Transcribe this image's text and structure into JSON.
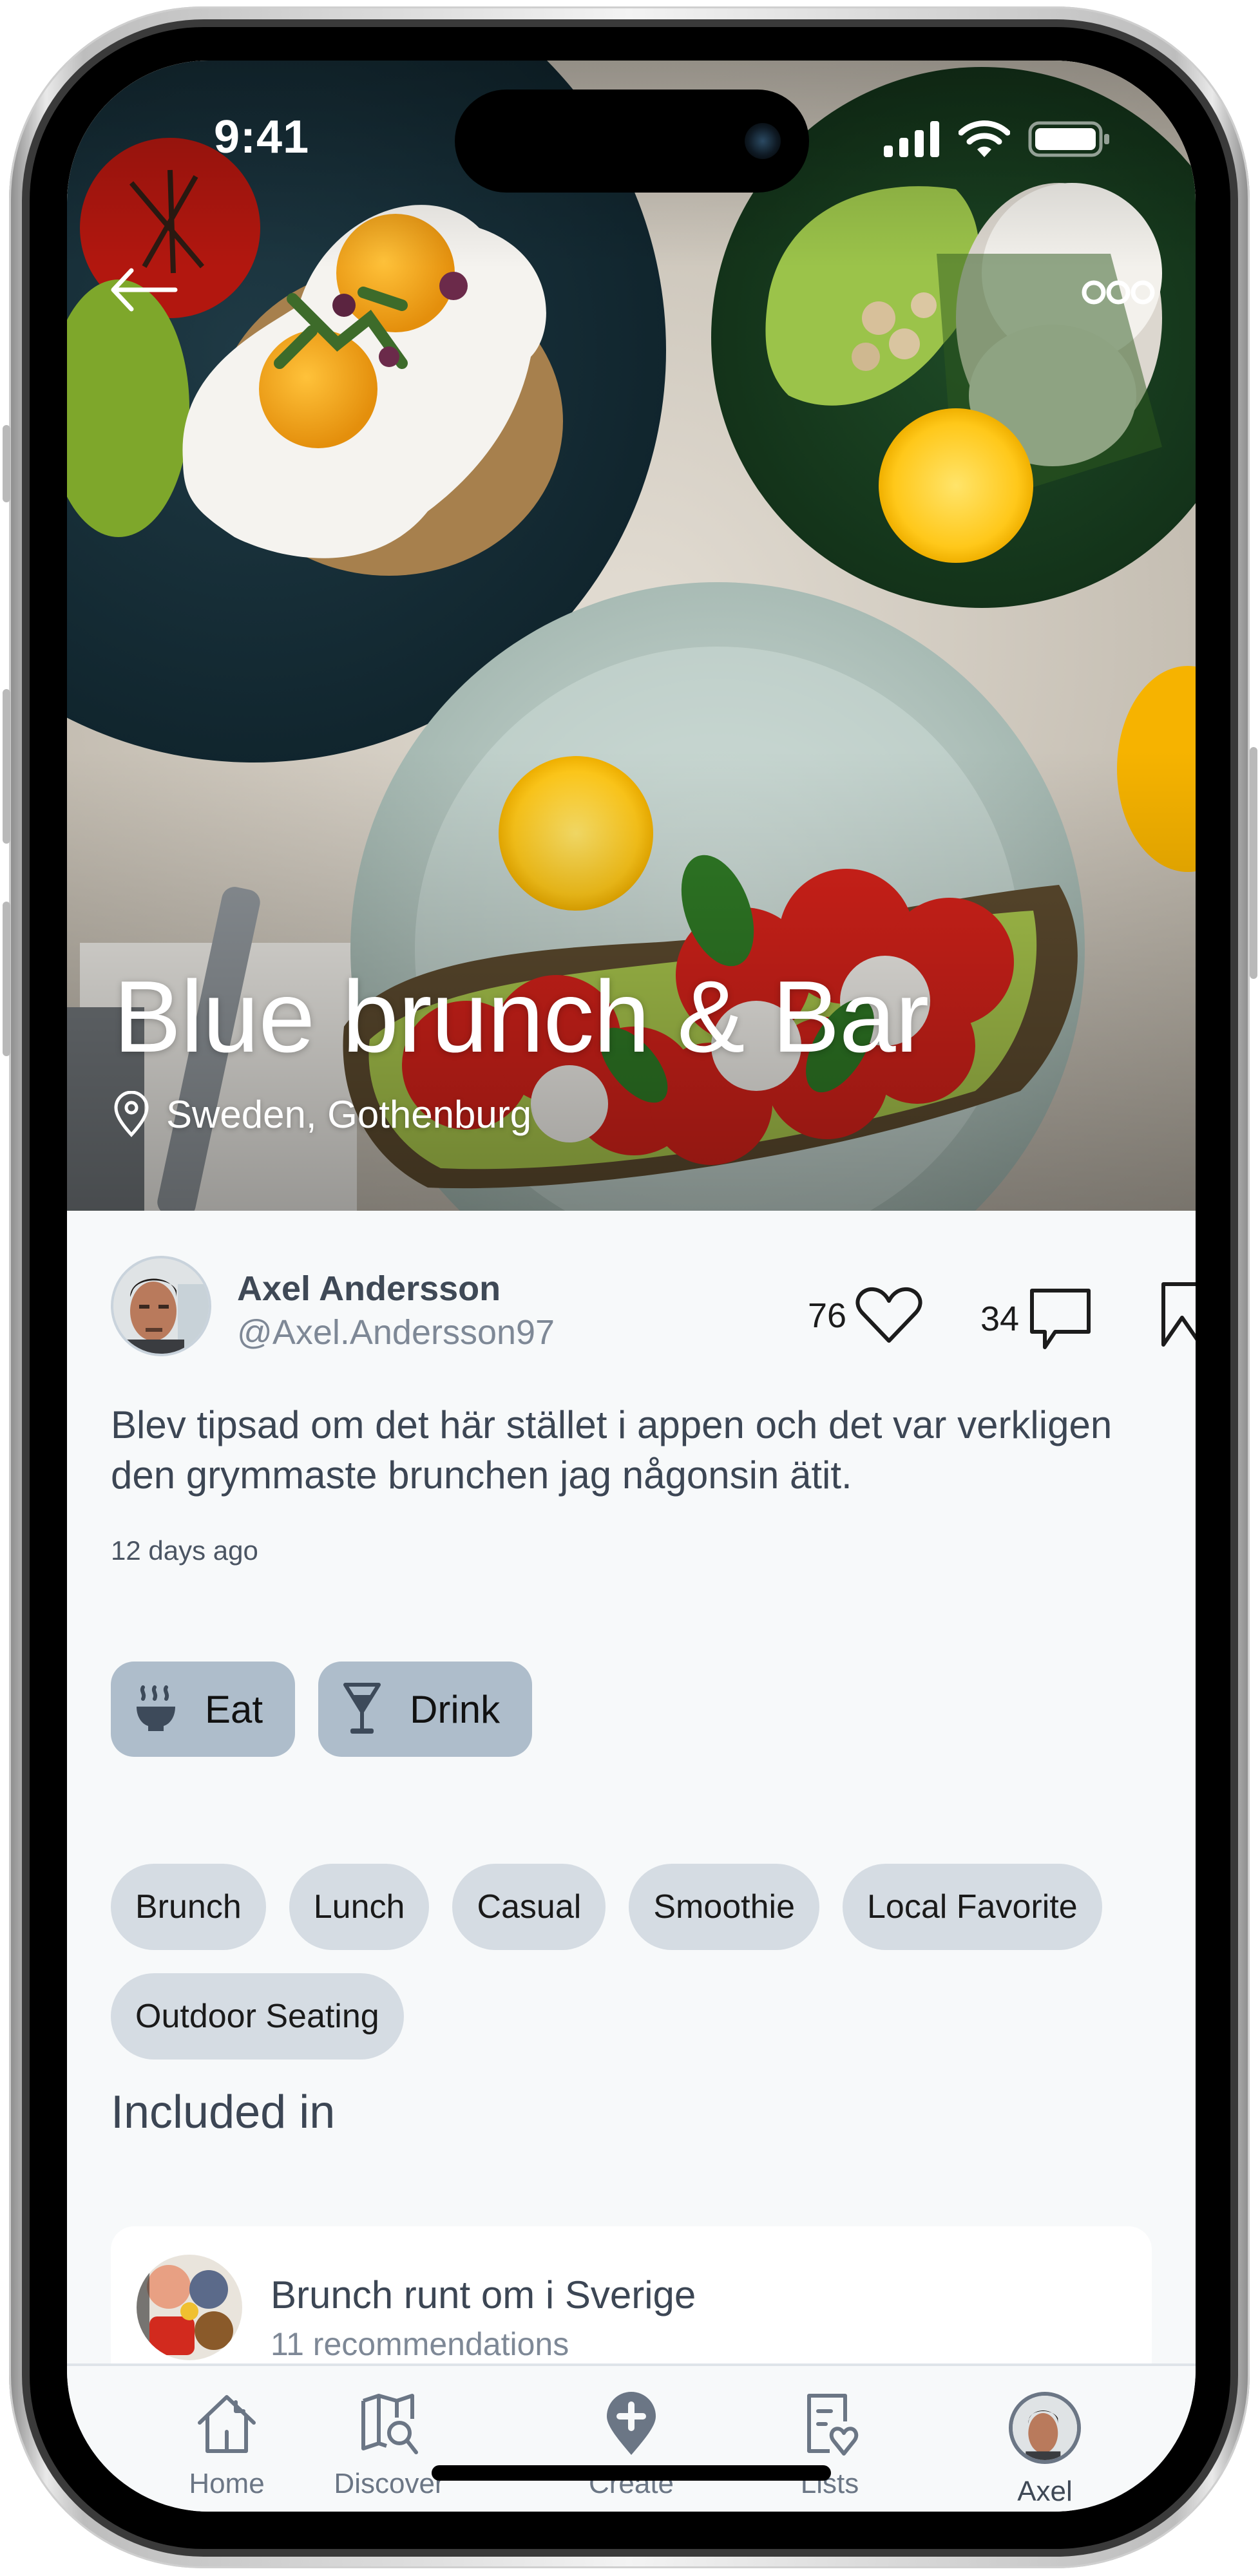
{
  "status_bar": {
    "time": "9:41",
    "icons": [
      "cellular-signal-icon",
      "wifi-icon",
      "battery-icon"
    ]
  },
  "hero": {
    "back_icon": "arrow-left-icon",
    "more_icon": "more-options-icon",
    "title": "Blue brunch & Bar",
    "location_icon": "location-pin-icon",
    "location": "Sweden, Gothenburg"
  },
  "post": {
    "author": {
      "name": "Axel Andersson",
      "handle": "@Axel.Andersson97"
    },
    "likes": "76",
    "comments": "34",
    "description": "Blev tipsad om det här stället i appen och det var verkligen den grymmaste brunchen jag någonsin ätit.",
    "timestamp": "12 days ago"
  },
  "categories": [
    {
      "label": "Eat",
      "icon": "bowl-steam-icon"
    },
    {
      "label": "Drink",
      "icon": "cocktail-glass-icon"
    }
  ],
  "tags": [
    "Brunch",
    "Lunch",
    "Casual",
    "Smoothie",
    "Local Favorite",
    "Outdoor Seating"
  ],
  "included_in": {
    "title": "Included in",
    "lists": [
      {
        "name": "Brunch runt om i Sverige",
        "count": "11 recommendations"
      }
    ]
  },
  "tabbar": {
    "items": [
      {
        "label": "Home",
        "icon": "home-icon",
        "active": false
      },
      {
        "label": "Discover",
        "icon": "map-search-icon",
        "active": false
      },
      {
        "label": "Create",
        "icon": "add-location-icon",
        "active": false
      },
      {
        "label": "Lists",
        "icon": "list-heart-icon",
        "active": false
      },
      {
        "label": "Axel",
        "icon": "profile-avatar",
        "active": true
      }
    ]
  },
  "colors": {
    "background": "#f7f9fa",
    "category_chip": "#aebdcb",
    "tag_chip": "#d5dce3",
    "text_primary": "#3c4654",
    "text_secondary": "#7e8896",
    "tab_icon": "#6b7685"
  }
}
